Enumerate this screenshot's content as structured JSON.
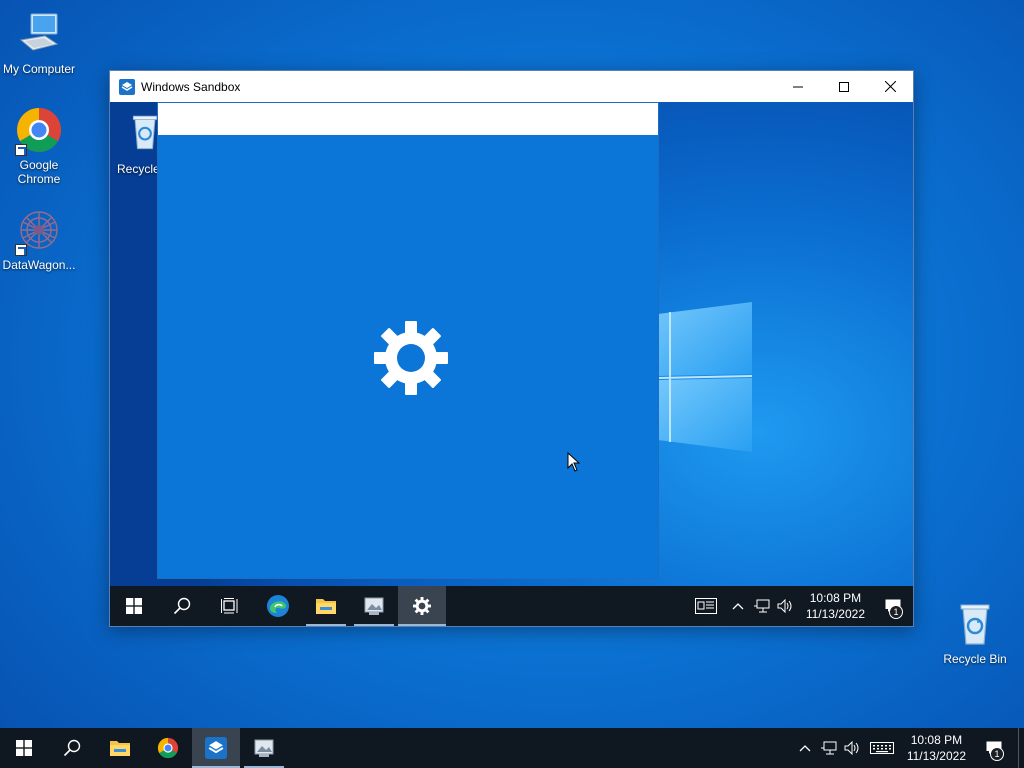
{
  "desktop": {
    "icons": [
      {
        "label": "My Computer",
        "icon": "computer-icon"
      },
      {
        "label": "Google Chrome",
        "icon": "chrome-icon"
      },
      {
        "label": "DataWagon...",
        "icon": "datawagon-icon"
      },
      {
        "label": "Recycle Bin",
        "icon": "recycle-bin-icon"
      }
    ]
  },
  "sandbox_window": {
    "title": "Windows Sandbox",
    "desktop_icon_label": "Recycle",
    "controls": {
      "minimize": "minimize-icon",
      "maximize": "maximize-icon",
      "close": "close-icon"
    }
  },
  "settings_window": {
    "title": "Settings",
    "splash_icon": "gear-icon"
  },
  "sandbox_taskbar": {
    "time": "10:08 PM",
    "date": "11/13/2022",
    "notification_count": "1",
    "apps": [
      "start",
      "search",
      "task-view",
      "edge",
      "file-explorer",
      "sandbox-app",
      "settings"
    ]
  },
  "taskbar": {
    "time": "10:08 PM",
    "date": "11/13/2022",
    "notification_count": "1",
    "apps": [
      "start",
      "search",
      "file-explorer",
      "chrome",
      "windows-sandbox",
      "photo-viewer"
    ]
  },
  "colors": {
    "desktop_blue": "#0a6fd0",
    "settings_blue": "#0c76d8",
    "taskbar": "#0f1720"
  }
}
